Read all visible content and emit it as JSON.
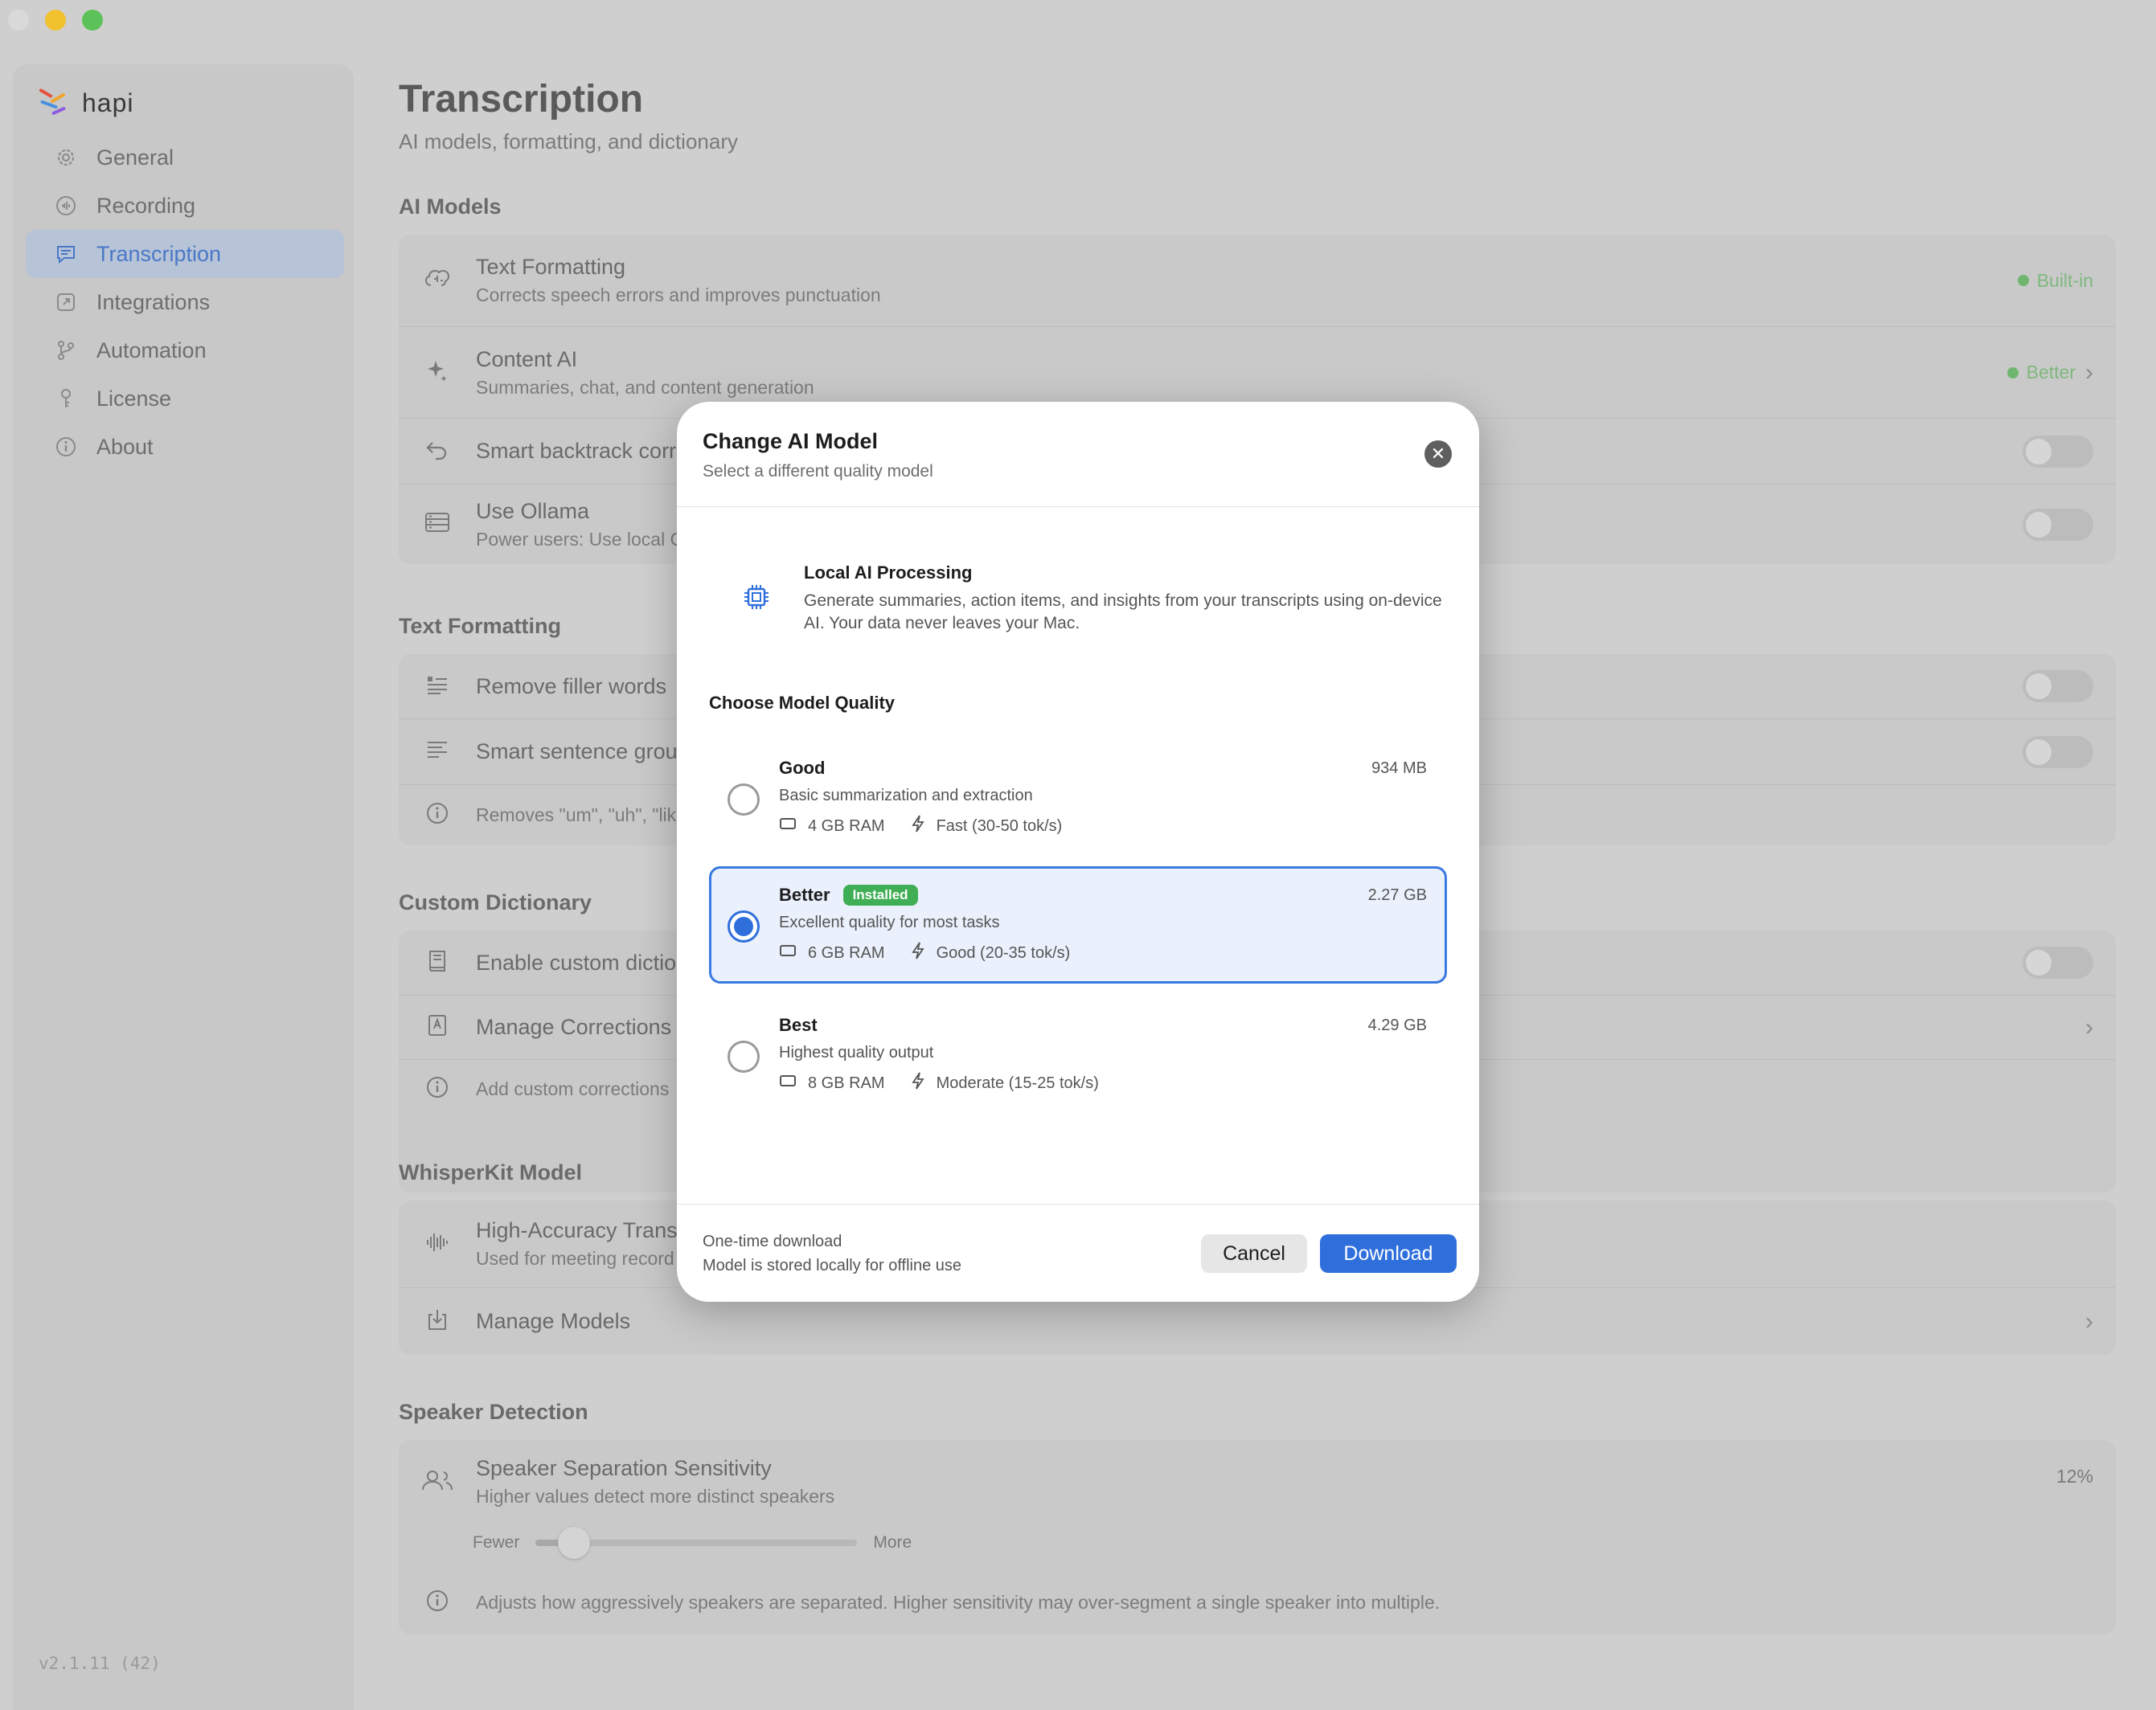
{
  "app": {
    "name": "hapi",
    "version": "v2.1.11 (42)"
  },
  "sidebar": {
    "items": [
      {
        "label": "General",
        "icon": "gear-icon"
      },
      {
        "label": "Recording",
        "icon": "record-icon"
      },
      {
        "label": "Transcription",
        "icon": "chat-icon",
        "active": true
      },
      {
        "label": "Integrations",
        "icon": "external-link-icon"
      },
      {
        "label": "Automation",
        "icon": "branch-icon"
      },
      {
        "label": "License",
        "icon": "key-icon"
      },
      {
        "label": "About",
        "icon": "info-icon"
      }
    ]
  },
  "page": {
    "title": "Transcription",
    "subtitle": "AI models, formatting, and dictionary"
  },
  "sections": {
    "ai_models": {
      "heading": "AI Models",
      "text_formatting": {
        "title": "Text Formatting",
        "sub": "Corrects speech errors and improves punctuation",
        "status": "Built-in"
      },
      "content_ai": {
        "title": "Content AI",
        "sub": "Summaries, chat, and content generation",
        "status": "Better"
      },
      "smart_backtrack": {
        "title": "Smart backtrack corr"
      },
      "use_ollama": {
        "title": "Use Ollama",
        "sub": "Power users: Use local O"
      }
    },
    "text_formatting": {
      "heading": "Text Formatting",
      "filler": {
        "title": "Remove filler words"
      },
      "sentence": {
        "title": "Smart sentence grou"
      },
      "note": {
        "text": "Removes \"um\", \"uh\", \"lik"
      }
    },
    "dictionary": {
      "heading": "Custom Dictionary",
      "enable": {
        "title": "Enable custom dictio"
      },
      "manage": {
        "title": "Manage Corrections"
      },
      "note": {
        "text": "Add custom corrections"
      }
    },
    "whisperkit": {
      "heading": "WhisperKit Model",
      "high_accuracy": {
        "title": "High-Accuracy Trans",
        "sub": "Used for meeting record"
      },
      "manage_models": {
        "title": "Manage Models"
      }
    },
    "speaker": {
      "heading": "Speaker Detection",
      "sensitivity": {
        "title": "Speaker Separation Sensitivity",
        "sub": "Higher values detect more distinct speakers",
        "value_label": "12%",
        "value": 0.12,
        "min_label": "Fewer",
        "max_label": "More"
      },
      "note": {
        "text": "Adjusts how aggressively speakers are separated. Higher sensitivity may over-segment a single speaker into multiple."
      }
    }
  },
  "modal": {
    "title": "Change AI Model",
    "subtitle": "Select a different quality model",
    "info_title": "Local AI Processing",
    "info_text": "Generate summaries, action items, and insights from your transcripts using on-device AI. Your data never leaves your Mac.",
    "choose_label": "Choose Model Quality",
    "options": [
      {
        "title": "Good",
        "size": "934 MB",
        "desc": "Basic summarization and extraction",
        "ram": "4 GB RAM",
        "speed": "Fast (30-50 tok/s)",
        "selected": false
      },
      {
        "title": "Better",
        "badge": "Installed",
        "size": "2.27 GB",
        "desc": "Excellent quality for most tasks",
        "ram": "6 GB RAM",
        "speed": "Good (20-35 tok/s)",
        "selected": true
      },
      {
        "title": "Best",
        "size": "4.29 GB",
        "desc": "Highest quality output",
        "ram": "8 GB RAM",
        "speed": "Moderate (15-25 tok/s)",
        "selected": false
      }
    ],
    "footer_line1": "One-time download",
    "footer_line2": "Model is stored locally for offline use",
    "cancel_label": "Cancel",
    "download_label": "Download"
  },
  "colors": {
    "accent": "#2f6fdc",
    "installed": "#3fae55",
    "status_green": "#6fb56f"
  }
}
